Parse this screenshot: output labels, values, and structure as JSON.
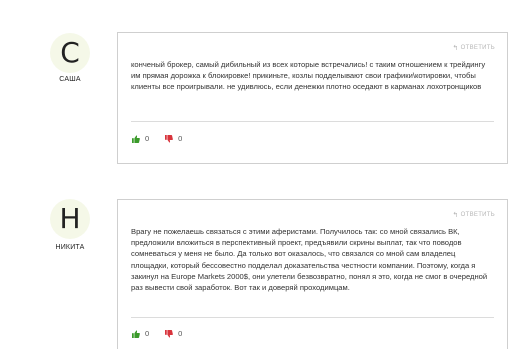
{
  "reply_label": "ОТВЕТИТЬ",
  "colors": {
    "like": "#3a9a2a",
    "dislike": "#d8343c"
  },
  "comments": [
    {
      "avatar_letter": "С",
      "author": "САША",
      "text": "конченый брокер, самый дибильный из всех которые встречались! с таким отношением к трейдингу им прямая дорожка к блокировке! прикиньте, козлы подделывают свои графики\\котировки, чтобы клиенты все проигрывали. не удивлюсь, если денежки плотно оседают в карманах лохотронщиков",
      "likes": "0",
      "dislikes": "0"
    },
    {
      "avatar_letter": "Н",
      "author": "НИКИТА",
      "text": "Врагу не пожелаешь связаться с этими аферистами. Получилось так: со мной связались ВК, предложили вложиться в перспективный проект, предъявили скрины выплат, так что поводов сомневаться у меня не было. Да только вот оказалось, что связался со мной сам владелец площадки, который бессовестно подделал доказательства честности компании. Поэтому, когда я закинул на Europe Markets 2000$, они улетели безвозвратно, понял я это, когда не смог в очередной раз вывести свой заработок. Вот так и доверяй проходимцам.",
      "likes": "0",
      "dislikes": "0"
    }
  ]
}
